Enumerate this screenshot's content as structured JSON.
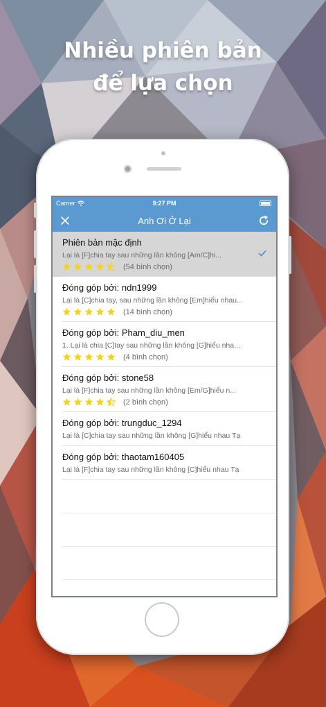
{
  "promo": {
    "headline_line1": "Nhiều phiên bản",
    "headline_line2": "để lựa chọn"
  },
  "status_bar": {
    "carrier": "Carrier",
    "time": "9:27 PM"
  },
  "nav": {
    "title": "Anh Ơi Ở Lại",
    "close_icon": "close-icon",
    "refresh_icon": "refresh-icon"
  },
  "colors": {
    "accent": "#5b9ad0",
    "star": "#f2d51b",
    "check": "#4a86c7"
  },
  "versions": [
    {
      "title": "Phiên bản mặc định",
      "snippet": "Lại là [F]chia tay sau những lần không [Am/C]hi...",
      "rating": 4.5,
      "votes": "(54 bình chọn)",
      "selected": true
    },
    {
      "title": "Đóng góp bởi: ndn1999",
      "snippet": "Lại là [C]chia tay, sau những lần không [Em]hiểu nhau...",
      "rating": 5,
      "votes": "(14 bình chọn)"
    },
    {
      "title": "Đóng góp bởi: Pham_diu_men",
      "snippet": "1. Lại là chia [C]tay sau những lần không [G]hiểu nha...",
      "rating": 5,
      "votes": "(4 bình chọn)"
    },
    {
      "title": "Đóng góp bởi: stone58",
      "snippet": "Lại là [F]chia tay sau những lần không [Em/G]hiểu n...",
      "rating": 4.5,
      "votes": "(2 bình chọn)"
    },
    {
      "title": "Đóng góp bởi: trungduc_1294",
      "snippet": "Lại là [C]chia tay sau những lần không [G]hiểu nhau Tạ"
    },
    {
      "title": "Đóng góp bởi: thaotam160405",
      "snippet": "Lại là [F]chia tay sau những lần không [C]hiểu nhau Tạ"
    }
  ]
}
